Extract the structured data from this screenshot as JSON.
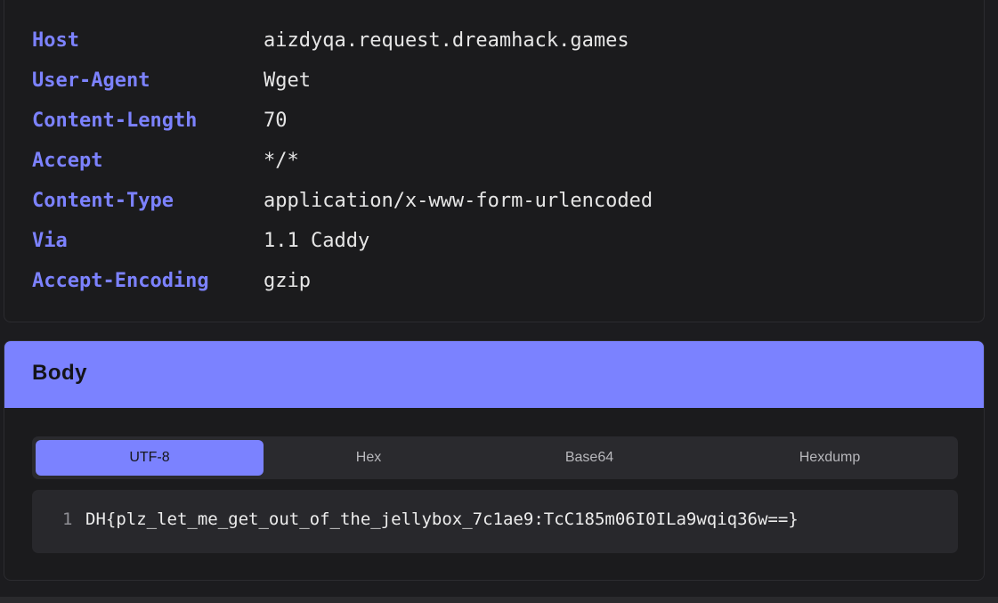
{
  "headers": [
    {
      "key": "Host",
      "value": "aizdyqa.request.dreamhack.games"
    },
    {
      "key": "User-Agent",
      "value": "Wget"
    },
    {
      "key": "Content-Length",
      "value": "70"
    },
    {
      "key": "Accept",
      "value": "*/*"
    },
    {
      "key": "Content-Type",
      "value": "application/x-www-form-urlencoded"
    },
    {
      "key": "Via",
      "value": "1.1 Caddy"
    },
    {
      "key": "Accept-Encoding",
      "value": "gzip"
    }
  ],
  "body": {
    "title": "Body",
    "tabs": [
      {
        "label": "UTF-8",
        "active": true
      },
      {
        "label": "Hex",
        "active": false
      },
      {
        "label": "Base64",
        "active": false
      },
      {
        "label": "Hexdump",
        "active": false
      }
    ],
    "lines": [
      {
        "number": "1",
        "text": "DH{plz_let_me_get_out_of_the_jellybox_7c1ae9:TcC185m06I0ILa9wqiq36w==}"
      }
    ]
  },
  "colors": {
    "accent": "#7b82ff",
    "header_key": "#7c82ff",
    "background": "#1c1c1f"
  }
}
